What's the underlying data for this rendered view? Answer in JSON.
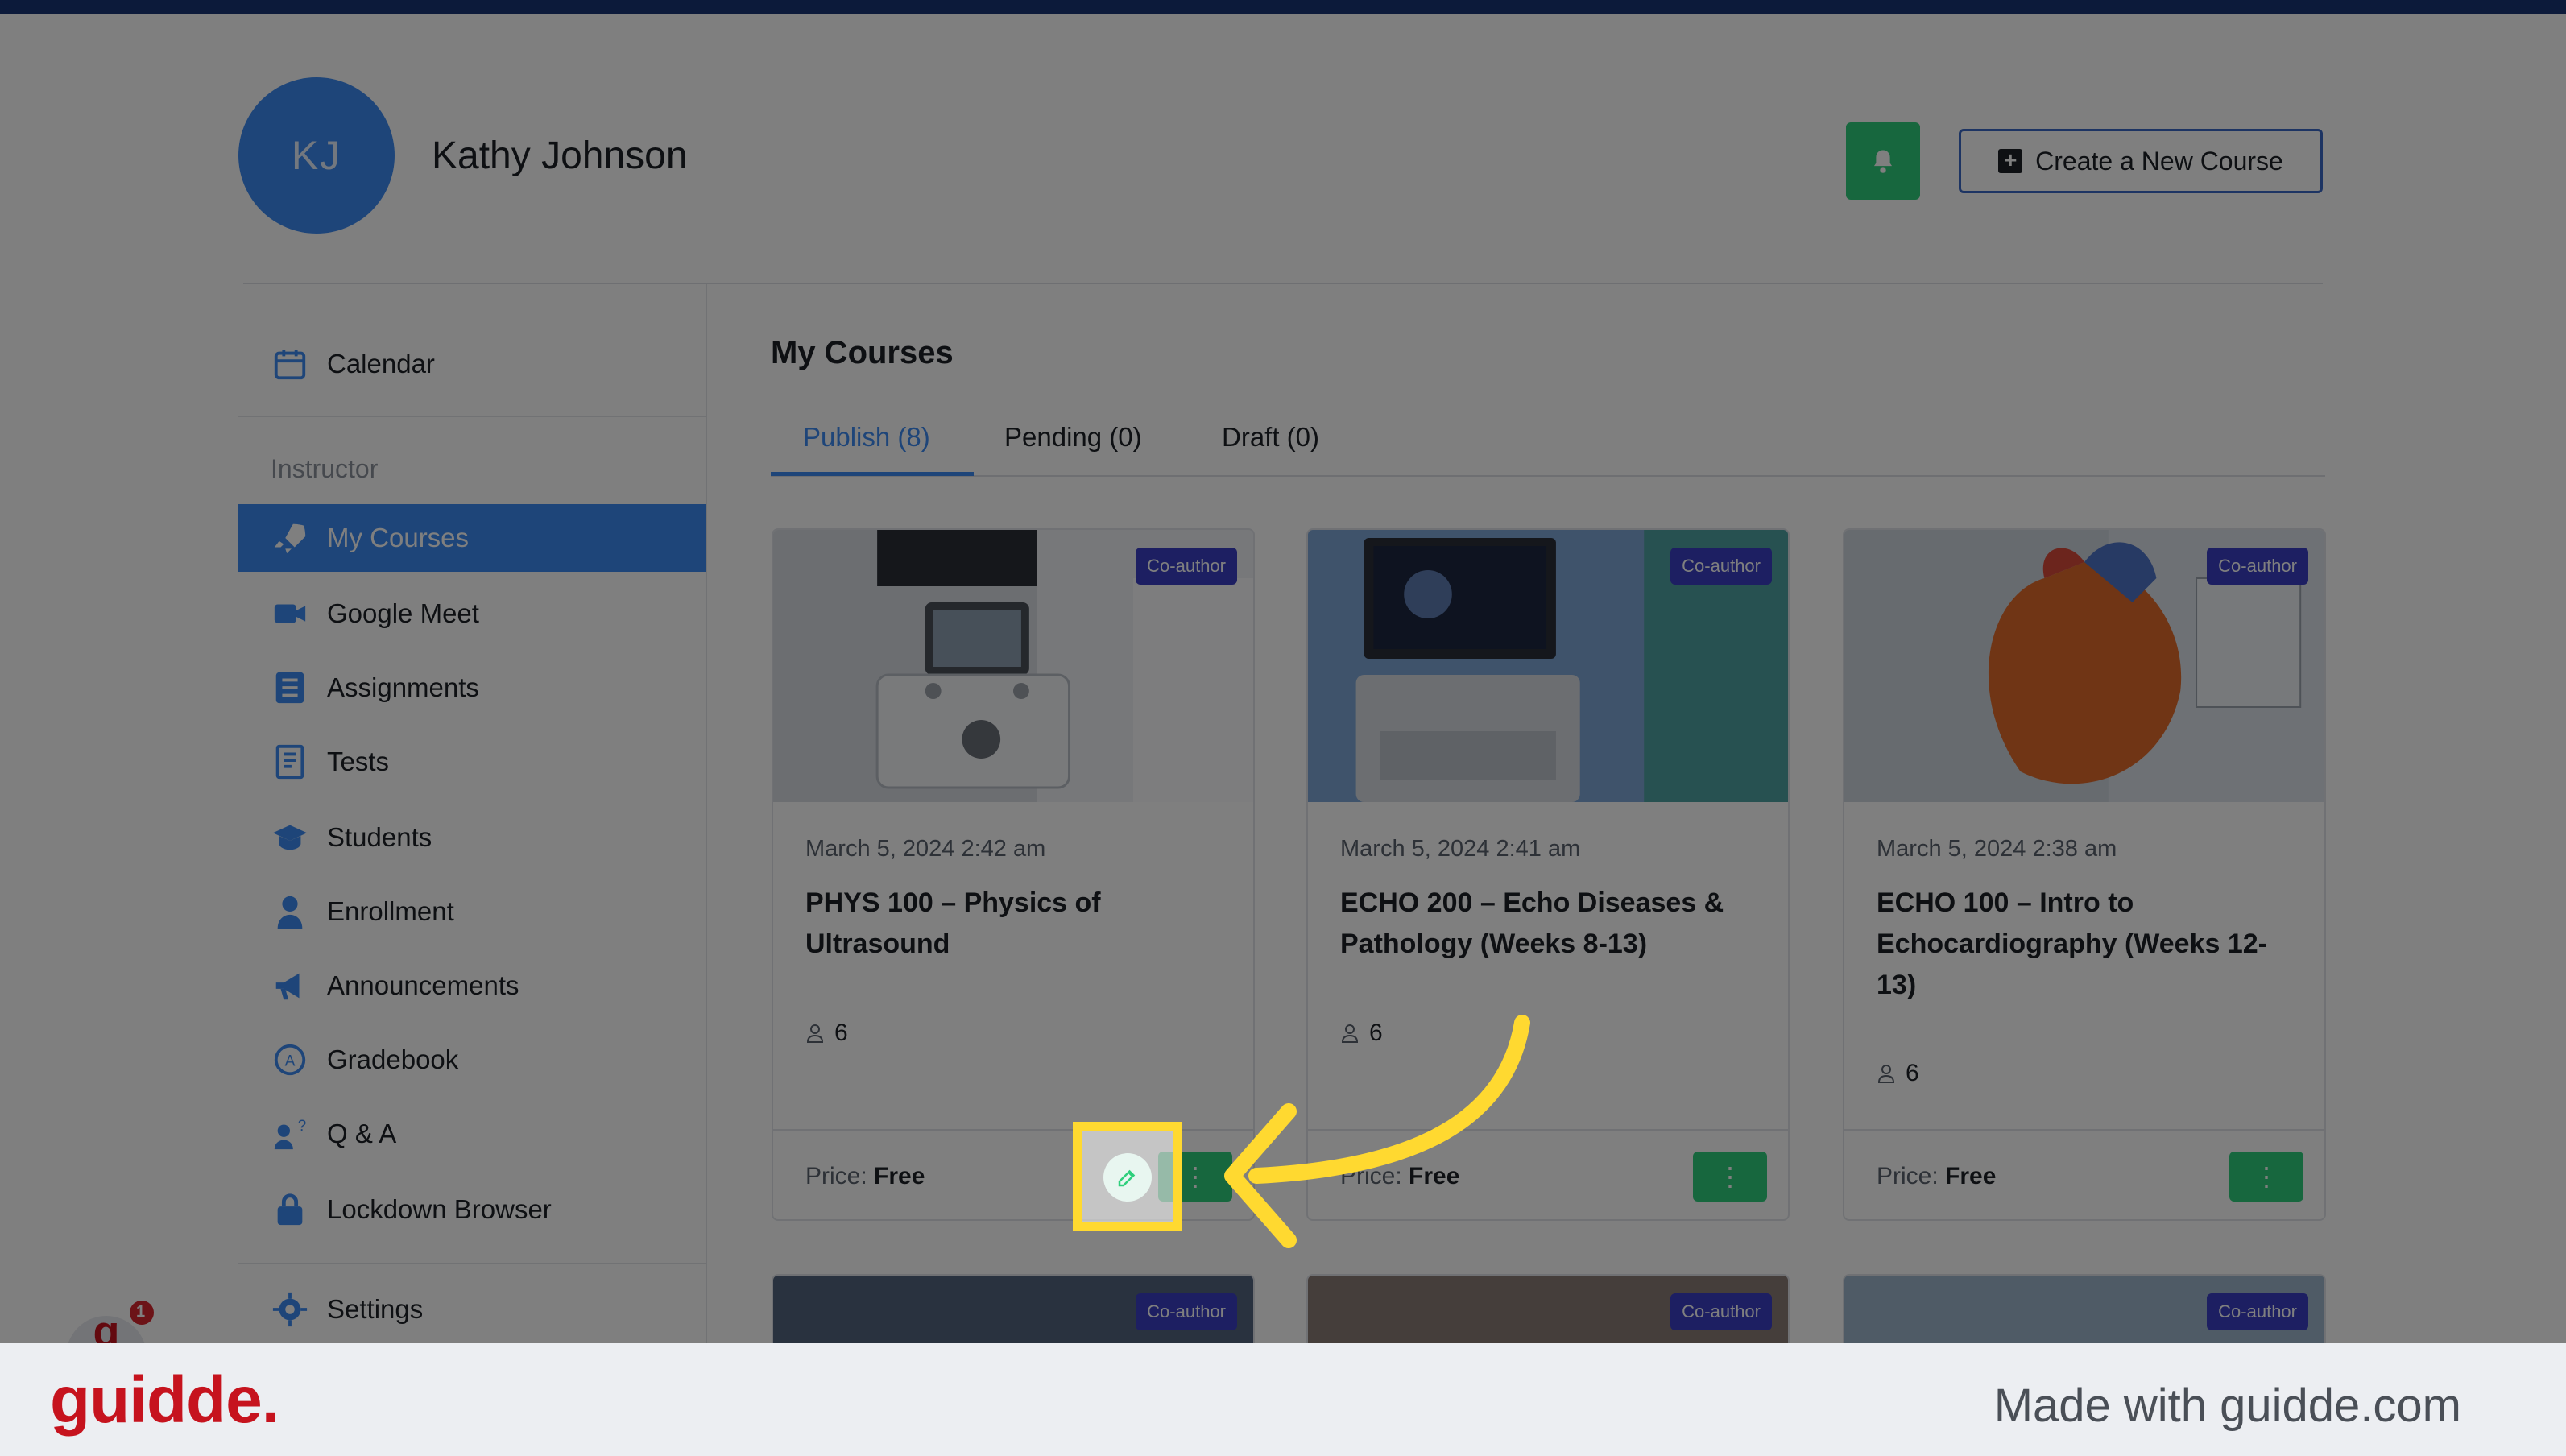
{
  "header": {
    "avatar_initials": "KJ",
    "user_name": "Kathy Johnson",
    "notification_icon": "bell-icon",
    "create_button_label": "Create a New Course",
    "accent_green": "#2ecf7c",
    "accent_blue": "#3d8bf2"
  },
  "sidebar": {
    "top_item": {
      "label": "Calendar",
      "icon": "calendar-icon"
    },
    "section_heading": "Instructor",
    "items": [
      {
        "label": "My Courses",
        "icon": "rocket-icon",
        "active": true
      },
      {
        "label": "Google Meet",
        "icon": "video-icon"
      },
      {
        "label": "Assignments",
        "icon": "checklist-icon"
      },
      {
        "label": "Tests",
        "icon": "test-sheet-icon"
      },
      {
        "label": "Students",
        "icon": "graduation-cap-icon"
      },
      {
        "label": "Enrollment",
        "icon": "user-icon"
      },
      {
        "label": "Announcements",
        "icon": "megaphone-icon"
      },
      {
        "label": "Gradebook",
        "icon": "gradebook-icon"
      },
      {
        "label": "Q & A",
        "icon": "qa-icon"
      },
      {
        "label": "Lockdown Browser",
        "icon": "lock-icon"
      }
    ],
    "settings": {
      "label": "Settings",
      "icon": "gear-icon"
    },
    "help_badge_count": "1"
  },
  "main": {
    "title": "My Courses",
    "tabs": [
      {
        "label": "Publish (8)",
        "active": true
      },
      {
        "label": "Pending (0)"
      },
      {
        "label": "Draft (0)"
      }
    ],
    "courses": [
      {
        "badge": "Co-author",
        "date": "March 5, 2024 2:42 am",
        "title": "PHYS 100 – Physics of Ultrasound",
        "students": "6",
        "price_label": "Price:",
        "price_value": "Free"
      },
      {
        "badge": "Co-author",
        "date": "March 5, 2024 2:41 am",
        "title": "ECHO 200 – Echo Diseases & Pathology (Weeks 8-13)",
        "students": "6",
        "price_label": "Price:",
        "price_value": "Free"
      },
      {
        "badge": "Co-author",
        "date": "March 5, 2024 2:38 am",
        "title": "ECHO 100 – Intro to Echocardiography (Weeks 12-13)",
        "students": "6",
        "price_label": "Price:",
        "price_value": "Free"
      }
    ],
    "more_courses_badges": [
      "Co-author",
      "Co-author",
      "Co-author"
    ],
    "more_button_glyph": "⋮"
  },
  "footer": {
    "brand": "guidde.",
    "made_with": "Made with guidde.com"
  }
}
